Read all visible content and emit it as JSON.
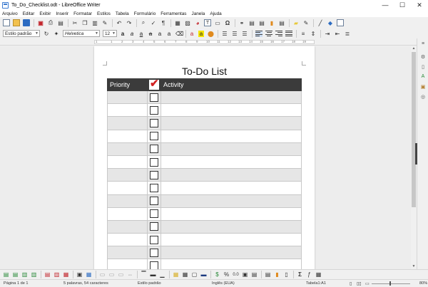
{
  "window": {
    "title": "To_Do_Checklist.odt - LibreOffice Writer",
    "min": "—",
    "max": "☐",
    "close": "✕"
  },
  "menu": [
    "Arquivo",
    "Editar",
    "Exibir",
    "Inserir",
    "Formatar",
    "Estilos",
    "Tabela",
    "Formulário",
    "Ferramentas",
    "Janela",
    "Ajuda"
  ],
  "format": {
    "style": "Estilo padrão",
    "font": "Helvetica",
    "size": "12"
  },
  "ruler_numbers": [
    "1",
    "1",
    "2",
    "3",
    "4",
    "5",
    "6",
    "7",
    "8",
    "9",
    "10",
    "11",
    "12",
    "13",
    "14",
    "15",
    "16",
    "17",
    "18",
    "19"
  ],
  "document": {
    "title": "To-Do List",
    "headers": {
      "priority": "Priority",
      "check": "✔",
      "activity": "Activity"
    },
    "row_count": 16
  },
  "status": {
    "page": "Página 1 de 1",
    "words": "5 palavras, 54 caracteres",
    "page_style": "Estilo padrão",
    "language": "Inglês (EUA)",
    "cell": "Tabela1:A1",
    "zoom": "80%"
  },
  "colors": {
    "header_bg": "#3b3b3b",
    "check_red": "#d02020",
    "row_shade": "#e6e6e6"
  }
}
